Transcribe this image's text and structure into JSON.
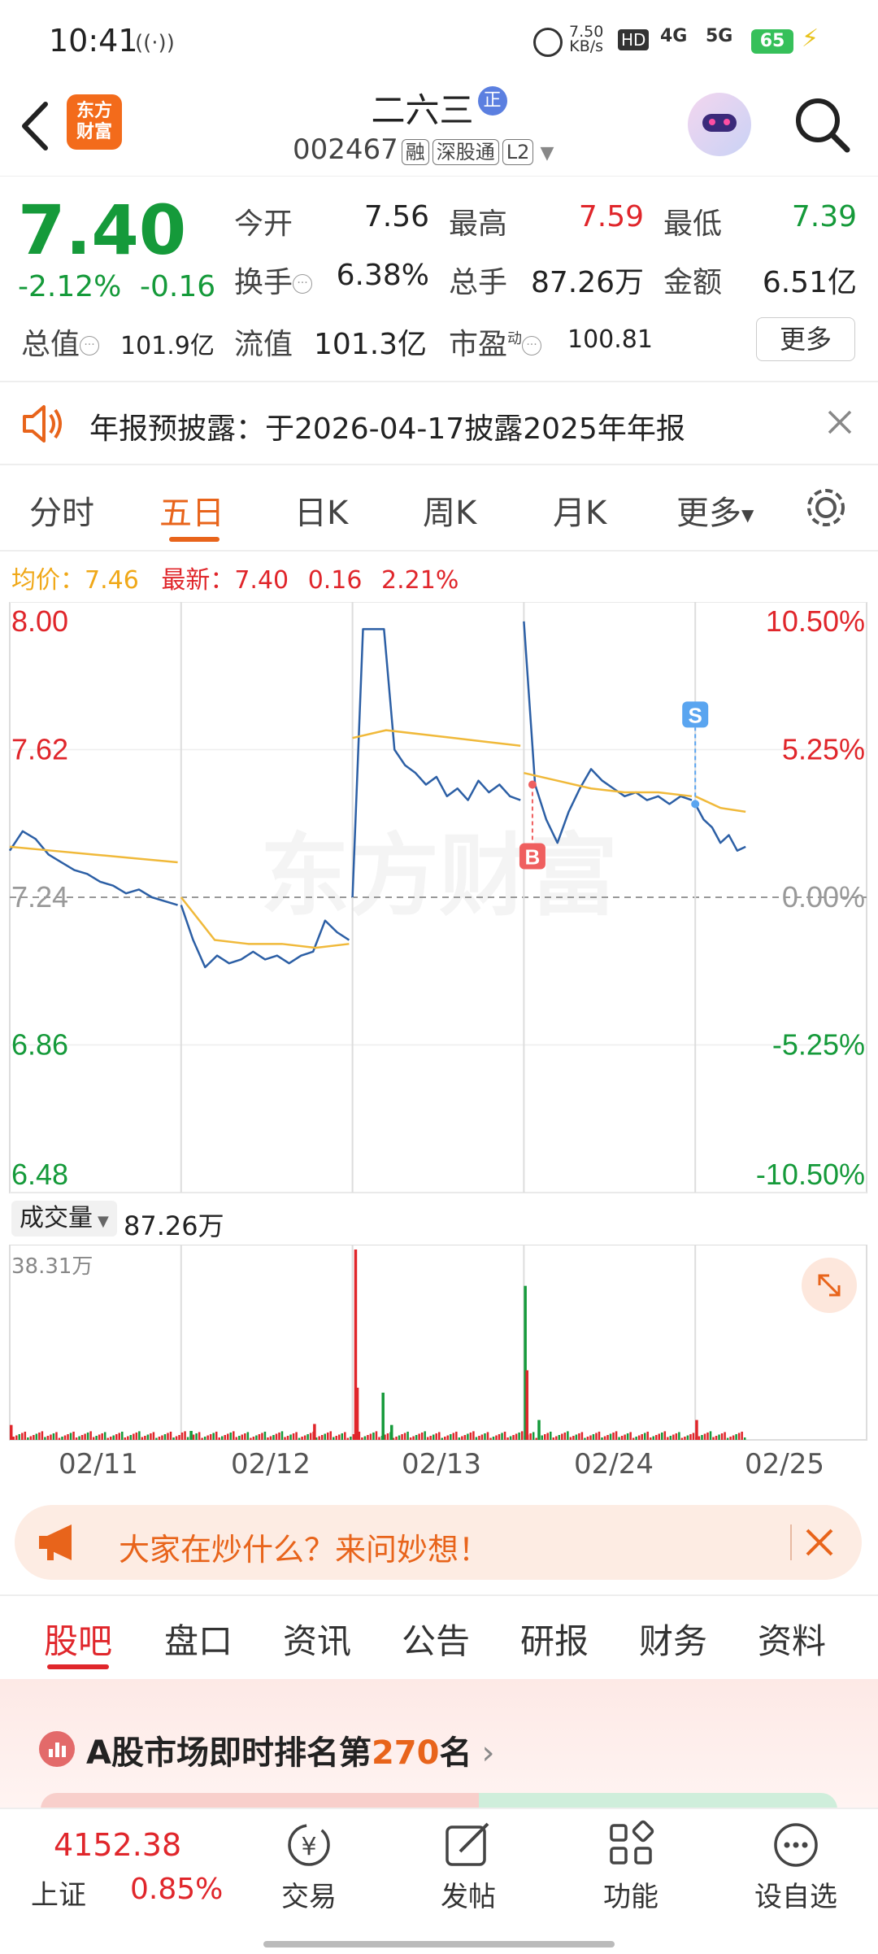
{
  "status_bar": {
    "time": "10:41",
    "net_speed_top": "7.50",
    "net_speed_unit": "KB/s",
    "hd_label": "HD",
    "net_4g": "4G",
    "net_5g": "5G",
    "battery": "65"
  },
  "header": {
    "logo_line1": "东方",
    "logo_line2": "财富",
    "stock_name": "二六三",
    "name_badge": "正",
    "stock_code": "002467",
    "tag_margin": "融",
    "tag_connect": "深股通",
    "tag_level": "L2"
  },
  "quote": {
    "price": "7.40",
    "change_pct": "-2.12%",
    "change_abs": "-0.16",
    "open_label": "今开",
    "open_value": "7.56",
    "high_label": "最高",
    "high_value": "7.59",
    "low_label": "最低",
    "low_value": "7.39",
    "turnover_label": "换手",
    "turnover_value": "6.38%",
    "volume_label": "总手",
    "volume_value": "87.26万",
    "amount_label": "金额",
    "amount_value": "6.51亿",
    "mktcap_label": "总值",
    "mktcap_value": "101.9亿",
    "float_label": "流值",
    "float_value": "101.3亿",
    "pe_label": "市盈",
    "pe_super": "动",
    "pe_value": "100.81",
    "more_label": "更多"
  },
  "notice": {
    "text": "年报预披露：于2026-04-17披露2025年年报"
  },
  "chart_tabs": [
    "分时",
    "五日",
    "日K",
    "周K",
    "月K",
    "更多"
  ],
  "active_chart_tab": 1,
  "chart_summary": {
    "avg_label": "均价：",
    "avg_value": "7.46",
    "latest_label": "最新：",
    "latest_value": "7.40",
    "latest_change": "0.16",
    "latest_pct": "2.21%"
  },
  "watermark": "东方财富",
  "volume_panel": {
    "selector_label": "成交量",
    "total": "87.26万",
    "max_label": "38.31万"
  },
  "promo": {
    "text": "大家在炒什么？来问妙想！"
  },
  "section_tabs": [
    "股吧",
    "盘口",
    "资讯",
    "公告",
    "研报",
    "财务",
    "资料"
  ],
  "active_section_tab": 0,
  "ranking": {
    "prefix": "A股市场即时排名第",
    "rank": "270",
    "suffix": "名"
  },
  "bottom_bar": {
    "index_value": "4152.38",
    "index_name": "上证",
    "index_pct": "0.85%",
    "items": [
      "交易",
      "发帖",
      "功能",
      "设自选"
    ]
  },
  "colors": {
    "up": "#e0262b",
    "down": "#159a3a",
    "accent": "#e8641b",
    "price_line": "#2c5fa5",
    "avg_line": "#f0b93a"
  },
  "chart_data": {
    "type": "line",
    "x_tick_labels": [
      "02/11",
      "02/12",
      "02/13",
      "02/24",
      "02/25"
    ],
    "y_left_ticks": [
      "8.00",
      "7.62",
      "7.24",
      "6.86",
      "6.48"
    ],
    "y_right_ticks": [
      "10.50%",
      "5.25%",
      "0.00%",
      "-5.25%",
      "-10.50%"
    ],
    "ylim": [
      6.48,
      8.0
    ],
    "prev_close": 7.24,
    "markers": [
      {
        "label": "B",
        "day": 3,
        "t": 0.05,
        "price": 7.53
      },
      {
        "label": "S",
        "day": 4,
        "t": 0.0,
        "price": 7.48
      }
    ],
    "series": [
      {
        "name": "最新",
        "days": [
          [
            7.36,
            7.41,
            7.39,
            7.35,
            7.33,
            7.31,
            7.3,
            7.28,
            7.27,
            7.25,
            7.26,
            7.24,
            7.23,
            7.22
          ],
          [
            7.22,
            7.13,
            7.06,
            7.09,
            7.07,
            7.08,
            7.1,
            7.08,
            7.09,
            7.07,
            7.09,
            7.1,
            7.18,
            7.15,
            7.13
          ],
          [
            7.24,
            7.93,
            7.93,
            7.93,
            7.62,
            7.58,
            7.56,
            7.53,
            7.55,
            7.5,
            7.52,
            7.49,
            7.54,
            7.51,
            7.53,
            7.5,
            7.49
          ],
          [
            7.95,
            7.53,
            7.44,
            7.38,
            7.46,
            7.52,
            7.57,
            7.54,
            7.52,
            7.5,
            7.51,
            7.49,
            7.5,
            7.48,
            7.5,
            7.49
          ],
          [
            7.48,
            7.44,
            7.42,
            7.38,
            7.4,
            7.36,
            7.37
          ]
        ]
      },
      {
        "name": "均价",
        "days": [
          [
            7.37,
            7.36,
            7.35,
            7.34,
            7.33
          ],
          [
            7.24,
            7.13,
            7.12,
            7.12,
            7.11,
            7.12
          ],
          [
            7.65,
            7.67,
            7.66,
            7.65,
            7.64,
            7.63
          ],
          [
            7.56,
            7.54,
            7.52,
            7.51,
            7.51,
            7.5
          ],
          [
            7.5,
            7.47,
            7.46
          ]
        ]
      }
    ],
    "volume": {
      "ylim": [
        0,
        38.31
      ],
      "unit": "万",
      "spikes": [
        {
          "day": 0,
          "t": 0.0,
          "value": 3.0,
          "color": "red"
        },
        {
          "day": 1,
          "t": 0.05,
          "value": 1.8,
          "color": "green"
        },
        {
          "day": 1,
          "t": 0.77,
          "value": 3.2,
          "color": "red"
        },
        {
          "day": 2,
          "t": 0.01,
          "value": 38.31,
          "color": "red"
        },
        {
          "day": 2,
          "t": 0.02,
          "value": 10.5,
          "color": "red"
        },
        {
          "day": 2,
          "t": 0.17,
          "value": 9.5,
          "color": "green"
        },
        {
          "day": 2,
          "t": 0.22,
          "value": 3.0,
          "color": "green"
        },
        {
          "day": 3,
          "t": 0.0,
          "value": 31.0,
          "color": "green"
        },
        {
          "day": 3,
          "t": 0.01,
          "value": 14.0,
          "color": "red"
        },
        {
          "day": 3,
          "t": 0.08,
          "value": 4.0,
          "color": "green"
        },
        {
          "day": 4,
          "t": 0.0,
          "value": 4.0,
          "color": "red"
        }
      ]
    }
  }
}
